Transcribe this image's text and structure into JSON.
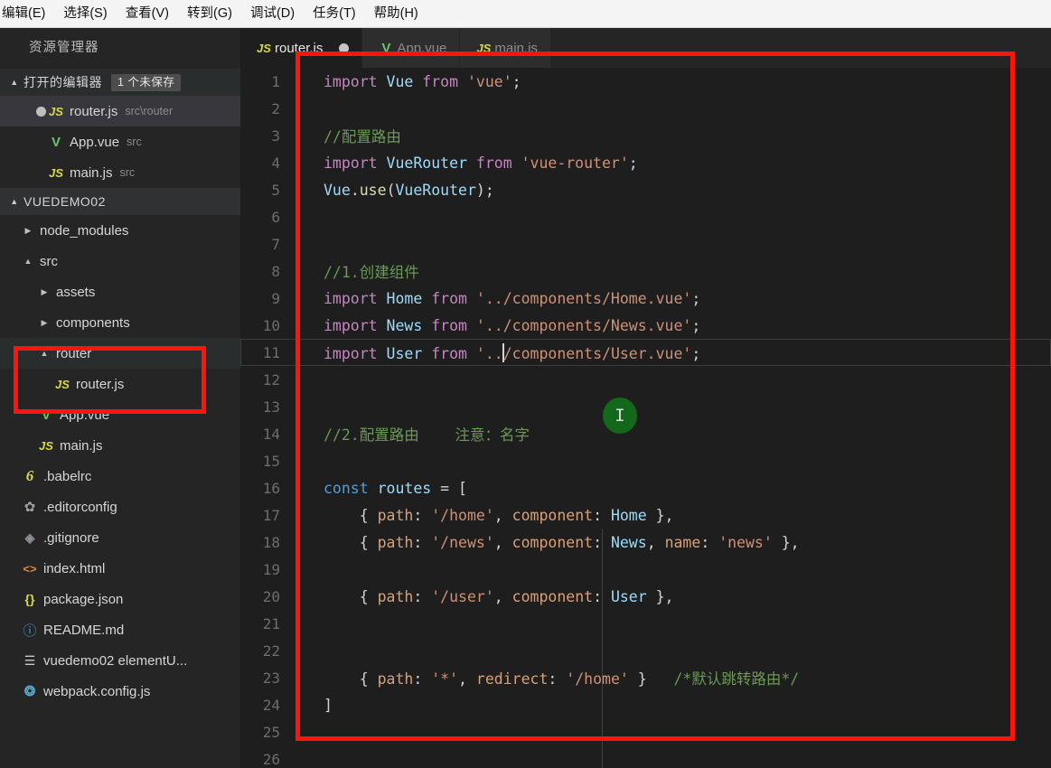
{
  "menubar": {
    "items": [
      {
        "label": "编辑(E)"
      },
      {
        "label": "选择(S)"
      },
      {
        "label": "查看(V)"
      },
      {
        "label": "转到(G)"
      },
      {
        "label": "调试(D)"
      },
      {
        "label": "任务(T)"
      },
      {
        "label": "帮助(H)"
      }
    ]
  },
  "sidebar": {
    "title": "资源管理器",
    "open_editors": {
      "label": "打开的编辑器",
      "badge": "1 个未保存",
      "twisty": "▲",
      "items": [
        {
          "name": "router.js",
          "meta": "src\\router",
          "icon": "js-file-icon",
          "icon_glyph": "JS",
          "dirty": true
        },
        {
          "name": "App.vue",
          "meta": "src",
          "icon": "vue-file-icon",
          "icon_glyph": "V",
          "dirty": false
        },
        {
          "name": "main.js",
          "meta": "src",
          "icon": "js-file-icon",
          "icon_glyph": "JS",
          "dirty": false
        }
      ]
    },
    "project": {
      "label": "VUEDEMO02",
      "twisty": "▲",
      "tree": [
        {
          "name": "node_modules",
          "type": "folder",
          "indent": 1,
          "arrow": "▶",
          "icon_glyph": "",
          "icon": "folder-icon"
        },
        {
          "name": "src",
          "type": "folder",
          "indent": 1,
          "arrow": "▲",
          "icon_glyph": "",
          "icon": "folder-icon"
        },
        {
          "name": "assets",
          "type": "folder",
          "indent": 2,
          "arrow": "▶",
          "icon_glyph": "",
          "icon": "folder-icon"
        },
        {
          "name": "components",
          "type": "folder",
          "indent": 2,
          "arrow": "▶",
          "icon_glyph": "",
          "icon": "folder-icon"
        },
        {
          "name": "router",
          "type": "folder",
          "indent": 2,
          "arrow": "▲",
          "icon_glyph": "",
          "icon": "folder-icon"
        },
        {
          "name": "router.js",
          "type": "file",
          "indent": 3,
          "arrow": "",
          "icon_glyph": "JS",
          "icon": "js-file-icon"
        },
        {
          "name": "App.vue",
          "type": "file",
          "indent": 2,
          "arrow": "",
          "icon_glyph": "V",
          "icon": "vue-file-icon"
        },
        {
          "name": "main.js",
          "type": "file",
          "indent": 2,
          "arrow": "",
          "icon_glyph": "JS",
          "icon": "js-file-icon"
        },
        {
          "name": ".babelrc",
          "type": "file",
          "indent": 1,
          "arrow": "",
          "icon_glyph": "6",
          "icon": "babel-icon"
        },
        {
          "name": ".editorconfig",
          "type": "file",
          "indent": 1,
          "arrow": "",
          "icon_glyph": "✿",
          "icon": "gear-icon"
        },
        {
          "name": ".gitignore",
          "type": "file",
          "indent": 1,
          "arrow": "",
          "icon_glyph": "◈",
          "icon": "git-icon"
        },
        {
          "name": "index.html",
          "type": "file",
          "indent": 1,
          "arrow": "",
          "icon_glyph": "<>",
          "icon": "html-icon"
        },
        {
          "name": "package.json",
          "type": "file",
          "indent": 1,
          "arrow": "",
          "icon_glyph": "{}",
          "icon": "json-icon"
        },
        {
          "name": "README.md",
          "type": "file",
          "indent": 1,
          "arrow": "",
          "icon_glyph": "ⓘ",
          "icon": "markdown-icon"
        },
        {
          "name": "vuedemo02 elementU...",
          "type": "file",
          "indent": 1,
          "arrow": "",
          "icon_glyph": "☰",
          "icon": "text-file-icon"
        },
        {
          "name": "webpack.config.js",
          "type": "file",
          "indent": 1,
          "arrow": "",
          "icon_glyph": "❂",
          "icon": "webpack-icon"
        }
      ]
    }
  },
  "editor": {
    "tabs": [
      {
        "label": "router.js",
        "icon_glyph": "JS",
        "icon": "js-file-icon",
        "active": true,
        "dirty": true
      },
      {
        "label": "App.vue",
        "icon_glyph": "V",
        "icon": "vue-file-icon",
        "active": false,
        "dirty": false
      },
      {
        "label": "main.js",
        "icon_glyph": "JS",
        "icon": "js-file-icon",
        "active": false,
        "dirty": false
      }
    ],
    "lines": [
      {
        "n": "1",
        "text": "import Vue from 'vue';"
      },
      {
        "n": "2",
        "text": ""
      },
      {
        "n": "3",
        "text": "//配置路由"
      },
      {
        "n": "4",
        "text": "import VueRouter from 'vue-router';"
      },
      {
        "n": "5",
        "text": "Vue.use(VueRouter);"
      },
      {
        "n": "6",
        "text": ""
      },
      {
        "n": "7",
        "text": ""
      },
      {
        "n": "8",
        "text": "//1.创建组件"
      },
      {
        "n": "9",
        "text": "import Home from '../components/Home.vue';"
      },
      {
        "n": "10",
        "text": "import News from '../components/News.vue';"
      },
      {
        "n": "11",
        "text": "import User from '../components/User.vue';"
      },
      {
        "n": "12",
        "text": ""
      },
      {
        "n": "13",
        "text": ""
      },
      {
        "n": "14",
        "text": "//2.配置路由    注意：名字"
      },
      {
        "n": "15",
        "text": ""
      },
      {
        "n": "16",
        "text": "const routes = ["
      },
      {
        "n": "17",
        "text": "    { path: '/home', component: Home },"
      },
      {
        "n": "18",
        "text": "    { path: '/news', component: News, name: 'news' },"
      },
      {
        "n": "19",
        "text": ""
      },
      {
        "n": "20",
        "text": "    { path: '/user', component: User },"
      },
      {
        "n": "21",
        "text": ""
      },
      {
        "n": "22",
        "text": ""
      },
      {
        "n": "23",
        "text": "    { path: '*', redirect: '/home' }   /*默认跳转路由*/"
      },
      {
        "n": "24",
        "text": "]"
      },
      {
        "n": "25",
        "text": ""
      },
      {
        "n": "26",
        "text": ""
      }
    ],
    "active_line": "11",
    "cursor_caret_line": "11"
  },
  "annotations": {
    "color": "#fe1408",
    "editor_box": "highlight-code-region",
    "sidebar_box": "highlight-router-folder"
  },
  "pointer": {
    "glyph": "I",
    "color": "#14681b"
  }
}
